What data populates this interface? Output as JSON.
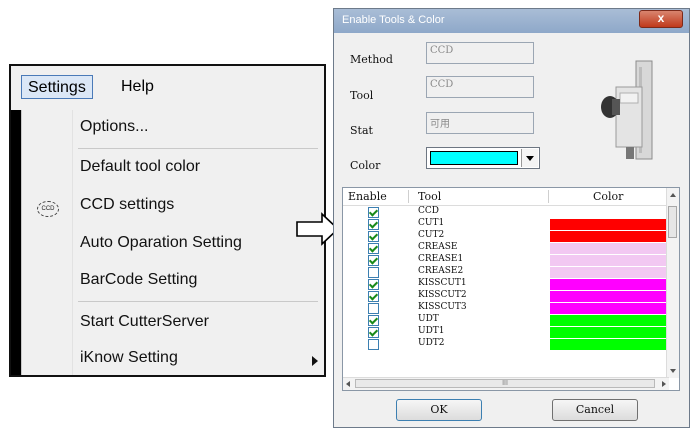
{
  "menu": {
    "menubar": {
      "settings": "Settings",
      "help": "Help"
    },
    "items": [
      {
        "label": "Options..."
      },
      {
        "label": "Default tool color"
      },
      {
        "label": "CCD settings",
        "icon": "ccd-icon",
        "icon_text": "CCD"
      },
      {
        "label": "Auto Oparation Setting"
      },
      {
        "label": "BarCode Setting"
      },
      {
        "label": "Start CutterServer"
      },
      {
        "label": "iKnow Setting",
        "has_submenu": true
      }
    ]
  },
  "dialog": {
    "title": "Enable Tools & Color",
    "close": "x",
    "fields": {
      "method": {
        "label": "Method",
        "value": "CCD"
      },
      "tool": {
        "label": "Tool",
        "value": "CCD"
      },
      "stat": {
        "label": "Stat",
        "value": "可用"
      },
      "color": {
        "label": "Color",
        "value": "#00ffff"
      }
    },
    "table": {
      "headers": {
        "enable": "Enable",
        "tool": "Tool",
        "color": "Color"
      },
      "scroll_marker": "III",
      "rows": [
        {
          "tool": "CCD",
          "enabled": true,
          "color": null
        },
        {
          "tool": "CUT1",
          "enabled": true,
          "color": "#ff0000"
        },
        {
          "tool": "CUT2",
          "enabled": true,
          "color": "#ff0000"
        },
        {
          "tool": "CREASE",
          "enabled": true,
          "color": "#f2c8f2"
        },
        {
          "tool": "CREASE1",
          "enabled": true,
          "color": "#f2c8f2"
        },
        {
          "tool": "CREASE2",
          "enabled": false,
          "color": "#f2c8f2"
        },
        {
          "tool": "KISSCUT1",
          "enabled": true,
          "color": "#ff00ff"
        },
        {
          "tool": "KISSCUT2",
          "enabled": true,
          "color": "#ff00ff"
        },
        {
          "tool": "KISSCUT3",
          "enabled": false,
          "color": "#ff00ff"
        },
        {
          "tool": "UDT",
          "enabled": true,
          "color": "#00ff00"
        },
        {
          "tool": "UDT1",
          "enabled": true,
          "color": "#00ff00"
        },
        {
          "tool": "UDT2",
          "enabled": false,
          "color": "#00ff00"
        }
      ]
    },
    "buttons": {
      "ok": "OK",
      "cancel": "Cancel"
    }
  }
}
